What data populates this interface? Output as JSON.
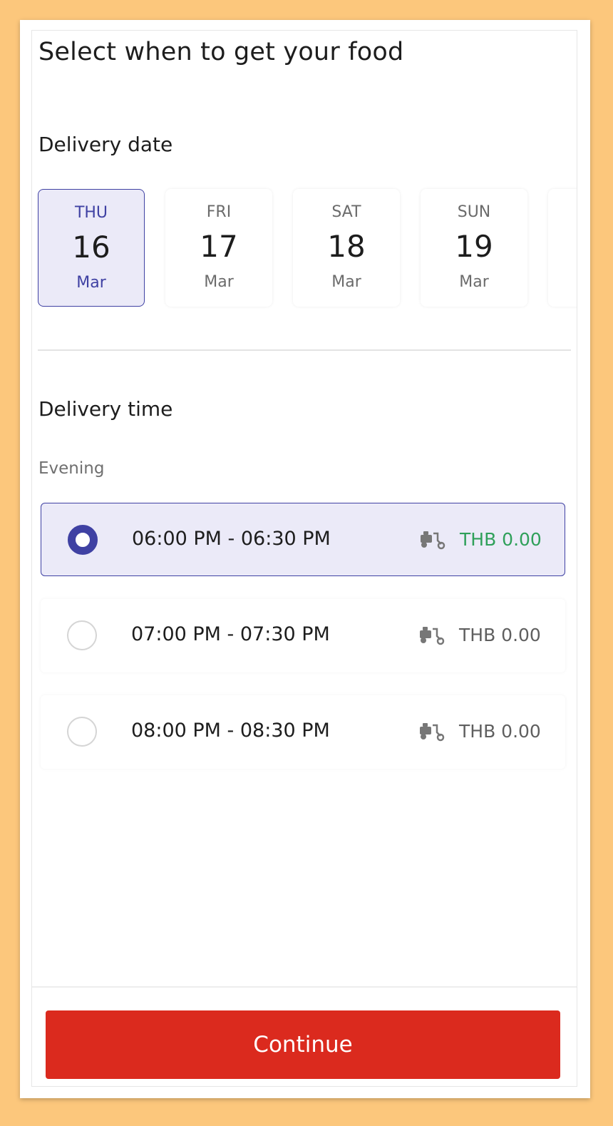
{
  "page": {
    "title": "Select when to get your food",
    "accent_color": "#3f41a3",
    "button_color": "#db2a1e",
    "free_price_color": "#2fa05a"
  },
  "delivery_date": {
    "label": "Delivery date",
    "dates": [
      {
        "dow": "THU",
        "day": "16",
        "month": "Mar",
        "selected": true
      },
      {
        "dow": "FRI",
        "day": "17",
        "month": "Mar",
        "selected": false
      },
      {
        "dow": "SAT",
        "day": "18",
        "month": "Mar",
        "selected": false
      },
      {
        "dow": "SUN",
        "day": "19",
        "month": "Mar",
        "selected": false
      }
    ]
  },
  "delivery_time": {
    "label": "Delivery time",
    "period": "Evening",
    "slots": [
      {
        "time": "06:00 PM - 06:30 PM",
        "price": "THB 0.00",
        "icon": "moped-icon",
        "selected": true
      },
      {
        "time": "07:00 PM - 07:30 PM",
        "price": "THB 0.00",
        "icon": "moped-icon",
        "selected": false
      },
      {
        "time": "08:00 PM - 08:30 PM",
        "price": "THB 0.00",
        "icon": "moped-icon",
        "selected": false
      }
    ]
  },
  "footer": {
    "continue_label": "Continue"
  }
}
